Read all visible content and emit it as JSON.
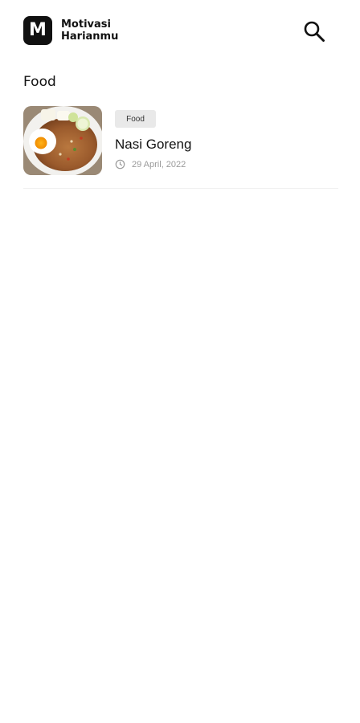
{
  "header": {
    "logo_letter": "M",
    "logo_line1": "Motivasi",
    "logo_line2": "Harianmu",
    "search_icon": "search-icon"
  },
  "section": {
    "title": "Food"
  },
  "articles": [
    {
      "tag": "Food",
      "title": "Nasi Goreng",
      "date": "29 April, 2022",
      "image": "nasi-goreng-photo",
      "date_icon": "clock-icon"
    }
  ],
  "colors": {
    "text": "#111111",
    "muted": "#9a9a9a",
    "tag_bg": "#e9e9e9",
    "logo_bg": "#111111"
  }
}
